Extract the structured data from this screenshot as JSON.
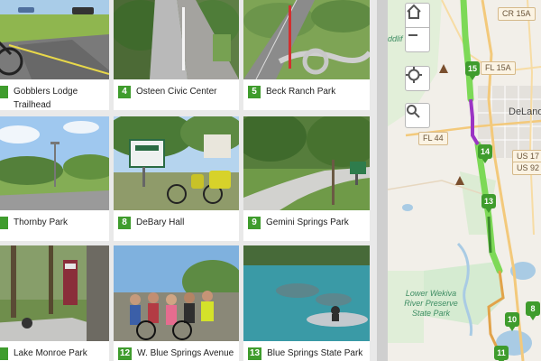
{
  "cards": [
    {
      "num": "",
      "label": "Gobblers Lodge Trailhead"
    },
    {
      "num": "4",
      "label": "Osteen Civic Center"
    },
    {
      "num": "5",
      "label": "Beck Ranch Park"
    },
    {
      "num": "",
      "label": "Thornby Park"
    },
    {
      "num": "8",
      "label": "DeBary Hall"
    },
    {
      "num": "9",
      "label": "Gemini Springs Park"
    },
    {
      "num": "",
      "label": "Lake Monroe Park"
    },
    {
      "num": "12",
      "label": "W. Blue Springs Avenue"
    },
    {
      "num": "13",
      "label": "Blue Springs State Park"
    }
  ],
  "map": {
    "roads": {
      "cr15a": "CR 15A",
      "fl15a": "FL 15A",
      "fl44": "FL 44",
      "us17": "US 17",
      "us92": "US 92"
    },
    "city": "DeLand",
    "park_lines": [
      "Lower Wekiva",
      "River Preserve",
      "State Park"
    ],
    "partial_label": "ddlif",
    "pins": [
      "15",
      "14",
      "13",
      "10",
      "8",
      "11"
    ],
    "icons": {
      "home": "home-icon",
      "zoom_out": "minus-icon",
      "locate": "crosshair-icon",
      "search": "search-icon",
      "camp": "triangle-marker-icon"
    },
    "colors": {
      "trail_green": "#7dd957",
      "trail_purple": "#9b34c4",
      "trail_orange": "#e2a34a",
      "marker": "#3f9c2d",
      "water": "#a9cbe4",
      "park": "#d5ebd1"
    }
  }
}
